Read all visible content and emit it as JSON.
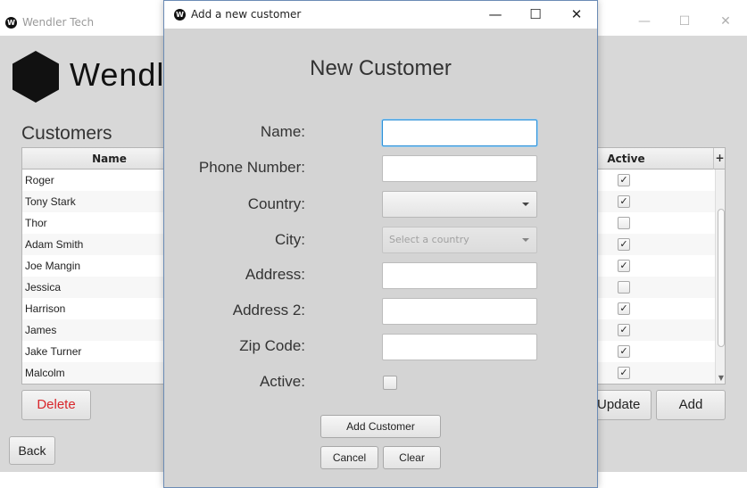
{
  "main_window": {
    "title": "Wendler Tech",
    "app_icon_letter": "W",
    "logo_text": "Wendler Tech",
    "customers_heading": "Customers",
    "table": {
      "headers": {
        "name": "Name",
        "active": "Active",
        "menu": "+"
      },
      "rows": [
        {
          "name": "Roger",
          "active": true
        },
        {
          "name": "Tony Stark",
          "active": true
        },
        {
          "name": "Thor",
          "active": false
        },
        {
          "name": "Adam Smith",
          "active": true
        },
        {
          "name": "Joe Mangin",
          "active": true
        },
        {
          "name": "Jessica",
          "active": false
        },
        {
          "name": "Harrison",
          "active": true
        },
        {
          "name": "James",
          "active": true
        },
        {
          "name": "Jake Turner",
          "active": true
        },
        {
          "name": "Malcolm",
          "active": true
        }
      ]
    },
    "buttons": {
      "delete": "Delete",
      "update": "Update",
      "add": "Add",
      "back": "Back"
    },
    "window_controls": {
      "minimize": "—",
      "maximize": "☐",
      "close": "✕"
    }
  },
  "dialog": {
    "title": "Add a new customer",
    "app_icon_letter": "W",
    "heading": "New Customer",
    "window_controls": {
      "minimize": "—",
      "maximize": "☐",
      "close": "✕"
    },
    "fields": {
      "name": {
        "label": "Name:",
        "value": ""
      },
      "phone": {
        "label": "Phone Number:",
        "value": ""
      },
      "country": {
        "label": "Country:",
        "value": ""
      },
      "city": {
        "label": "City:",
        "placeholder": "Select a country"
      },
      "address": {
        "label": "Address:",
        "value": ""
      },
      "address2": {
        "label": "Address 2:",
        "value": ""
      },
      "zip": {
        "label": "Zip Code:",
        "value": ""
      },
      "active": {
        "label": "Active:",
        "checked": false
      }
    },
    "buttons": {
      "add_customer": "Add Customer",
      "cancel": "Cancel",
      "clear": "Clear"
    }
  },
  "colors": {
    "delete_text": "#d9262b",
    "focus_border": "#2c8fd6",
    "window_bg": "#d8d8d8"
  }
}
